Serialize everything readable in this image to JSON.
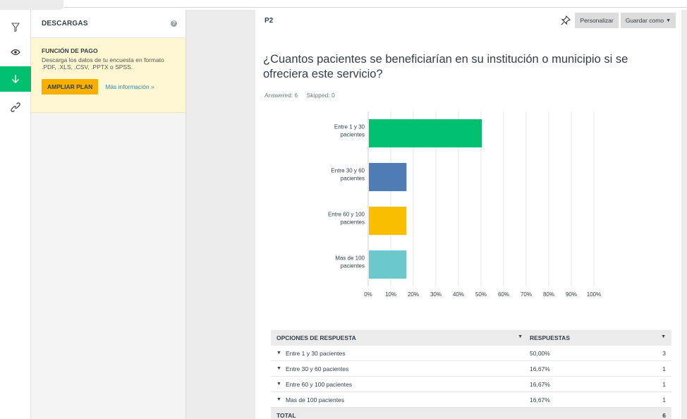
{
  "sidebar": {
    "icons": [
      "filter-icon",
      "eye-icon",
      "download-icon",
      "link-icon"
    ],
    "active_color": "#00bf6f"
  },
  "downloads": {
    "title": "DESCARGAS",
    "promo_title": "FUNCIÓN DE PAGO",
    "promo_desc": "Descarga los datos de tu encuesta en formato .PDF, .XLS, .CSV, .PPTX o SPSS.",
    "upgrade_label": "AMPLIAR PLAN",
    "more_label": "Más información »"
  },
  "question": {
    "number": "P2",
    "text": "¿Cuantos pacientes se beneficiarían en su institución o municipio si se ofreciera este servicio?",
    "answered": "Answered: 6",
    "skipped": "Skipped: 0"
  },
  "toolbar": {
    "customize_label": "Personalizar",
    "save_label": "Guardar como"
  },
  "chart_data": {
    "type": "bar",
    "orientation": "horizontal",
    "categories": [
      [
        "Entre 1 y 30",
        "pacientes"
      ],
      [
        "Entre 30 y 60",
        "pacientes"
      ],
      [
        "Entre 60 y 100",
        "pacientes"
      ],
      [
        "Mas de 100",
        "pacientes"
      ]
    ],
    "values": [
      50.0,
      16.67,
      16.67,
      16.67
    ],
    "colors": [
      "#00bf6f",
      "#507cb6",
      "#f9be00",
      "#6bc8cd"
    ],
    "xlim": [
      0,
      100
    ],
    "xticks": [
      "0%",
      "10%",
      "20%",
      "30%",
      "40%",
      "50%",
      "60%",
      "70%",
      "80%",
      "90%",
      "100%"
    ],
    "grid": true
  },
  "table": {
    "col_options": "OPCIONES DE RESPUESTA",
    "col_responses": "RESPUESTAS",
    "rows": [
      {
        "label": "Entre 1 y 30 pacientes",
        "pct": "50,00%",
        "count": "3"
      },
      {
        "label": "Entre 30 y 60 pacientes",
        "pct": "16,67%",
        "count": "1"
      },
      {
        "label": "Entre 60 y 100 pacientes",
        "pct": "16,67%",
        "count": "1"
      },
      {
        "label": "Mas de 100 pacientes",
        "pct": "16,67%",
        "count": "1"
      }
    ],
    "total_label": "TOTAL",
    "total_count": "6"
  }
}
